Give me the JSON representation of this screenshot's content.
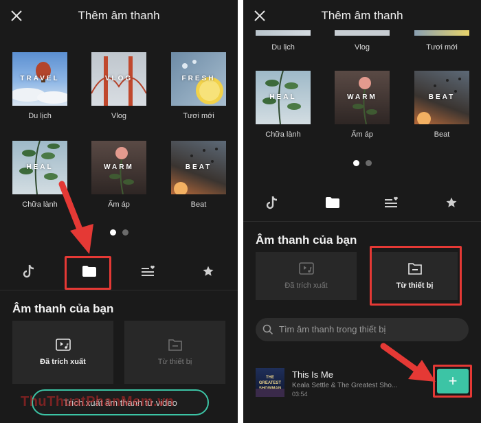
{
  "left": {
    "title": "Thêm âm thanh",
    "categories": [
      {
        "label": "Du lịch",
        "tag": "TRAVEL"
      },
      {
        "label": "Vlog",
        "tag": "VLOG"
      },
      {
        "label": "Tươi mới",
        "tag": "FRESH"
      },
      {
        "label": "Chữa lành",
        "tag": "HEAL"
      },
      {
        "label": "Ấm áp",
        "tag": "WARM"
      },
      {
        "label": "Beat",
        "tag": "BEAT"
      }
    ],
    "page_indicator": {
      "active": 1,
      "total": 2
    },
    "tabs": [
      "tiktok-icon",
      "folder-icon",
      "playlist-heart-icon",
      "star-icon"
    ],
    "selected_tab": 1,
    "section_title": "Âm thanh của bạn",
    "cards": [
      {
        "label": "Đã trích xuất",
        "icon": "video-music-icon"
      },
      {
        "label": "Từ thiết bị",
        "icon": "folder-outline-icon"
      }
    ],
    "extract_button": "Trích xuất âm thanh từ video",
    "watermark": "ThuThuatPhanMem.vn"
  },
  "right": {
    "title": "Thêm âm thanh",
    "top_labels": [
      "Du lịch",
      "Vlog",
      "Tươi mới"
    ],
    "categories": [
      {
        "label": "Chữa lành",
        "tag": "HEAL"
      },
      {
        "label": "Ấm áp",
        "tag": "WARM"
      },
      {
        "label": "Beat",
        "tag": "BEAT"
      }
    ],
    "page_indicator": {
      "active": 1,
      "total": 2
    },
    "tabs": [
      "tiktok-icon",
      "folder-icon",
      "playlist-heart-icon",
      "star-icon"
    ],
    "selected_tab": 1,
    "section_title": "Âm thanh của bạn",
    "cards": [
      {
        "label": "Đã trích xuất",
        "icon": "video-music-icon"
      },
      {
        "label": "Từ thiết bị",
        "icon": "folder-outline-icon"
      }
    ],
    "search_placeholder": "Tìm âm thanh trong thiết bị",
    "track": {
      "title": "This Is Me",
      "artist": "Keala Settle & The Greatest Sho...",
      "duration": "03:54",
      "cover_text": "THE GREATEST SHOWMAN"
    },
    "add_button": "+"
  },
  "colors": {
    "accent": "#3cc4a5",
    "annotation": "#e53935",
    "panel": "#1a1a1a",
    "card": "#282828"
  }
}
